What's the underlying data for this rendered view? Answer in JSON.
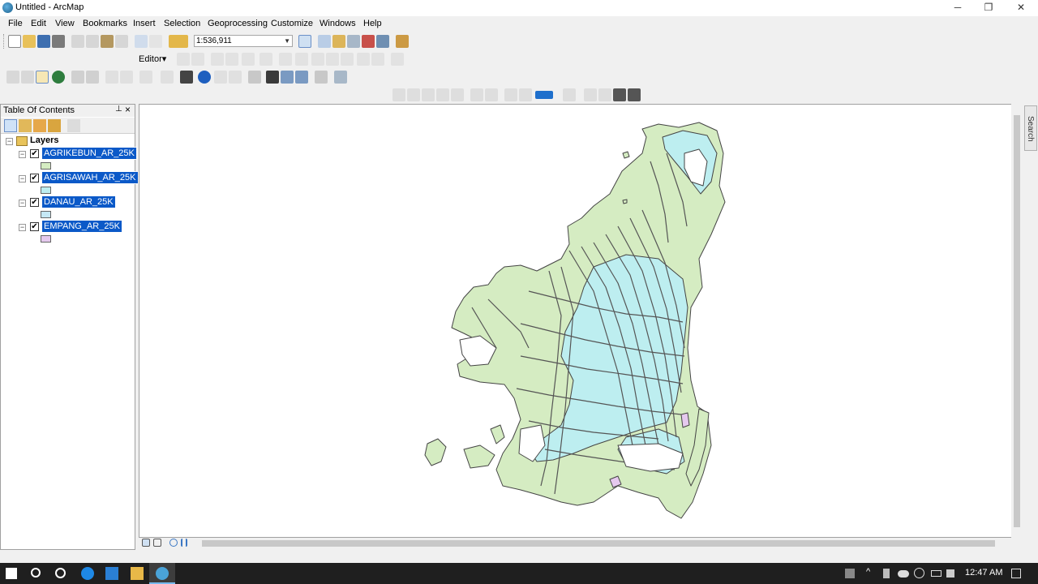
{
  "window": {
    "title": "Untitled - ArcMap",
    "minimize": "─",
    "restore": "❐",
    "close": "✕"
  },
  "menu": [
    "File",
    "Edit",
    "View",
    "Bookmarks",
    "Insert",
    "Selection",
    "Geoprocessing",
    "Customize",
    "Windows",
    "Help"
  ],
  "toolbar": {
    "scale_value": "1:536,911",
    "editor_label": "Editor▾"
  },
  "toc": {
    "title": "Table Of Contents",
    "root": "Layers",
    "layers": [
      {
        "name": "AGRIKEBUN_AR_25K",
        "checked": "✔",
        "color": "#d5ecc2"
      },
      {
        "name": "AGRISAWAH_AR_25K",
        "checked": "✔",
        "color": "#bdeef0"
      },
      {
        "name": "DANAU_AR_25K",
        "checked": "✔",
        "color": "#c5e8f5"
      },
      {
        "name": "EMPANG_AR_25K",
        "checked": "✔",
        "color": "#e5c9ee"
      }
    ]
  },
  "search_tab": "Search",
  "taskbar": {
    "time": "12:47 AM"
  }
}
